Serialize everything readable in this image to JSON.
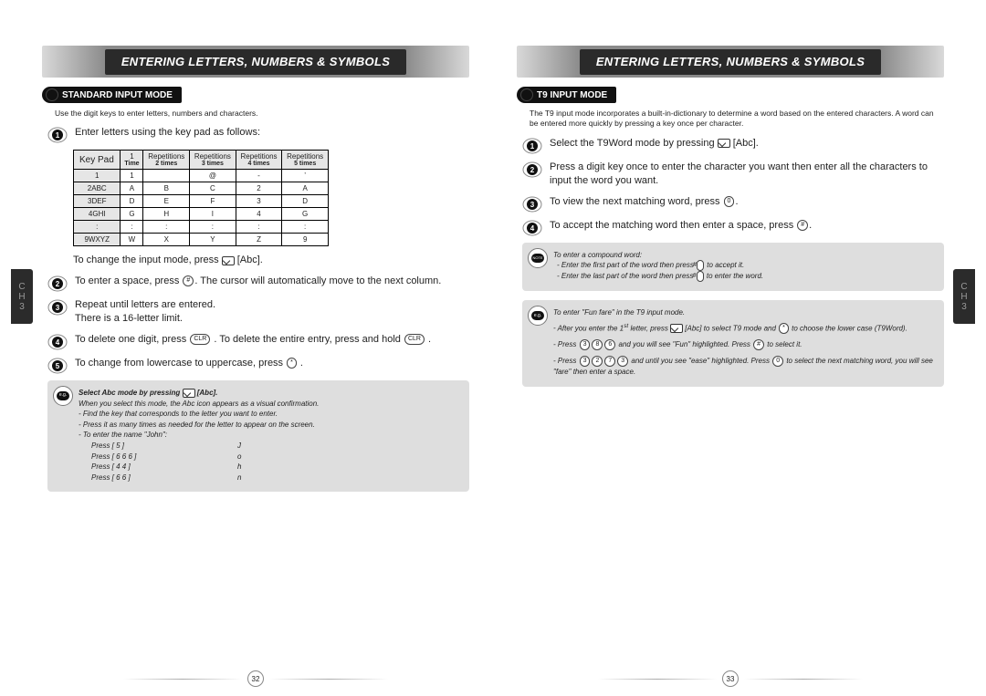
{
  "header": "ENTERING LETTERS, NUMBERS & SYMBOLS",
  "chapter_tab": {
    "line1": "C",
    "line2": "H",
    "line3": "3"
  },
  "left": {
    "section_title": "STANDARD INPUT MODE",
    "intro": "Use the digit keys to enter letters, numbers and characters.",
    "step1_a": "Enter letters using the key pad as follows:",
    "step1_b": "To change the input mode, press ",
    "step1_b2": " [Abc].",
    "step2": "To enter a space, press ",
    "step2b": ". The cursor will automatically move to the next column.",
    "step3a": "Repeat until letters are entered.",
    "step3b": "There is a 16-letter limit.",
    "step4a": "To delete one digit, press ",
    "step4b": " . To delete the entire entry, press and hold ",
    "step4c": " .",
    "step5a": "To change from lowercase to uppercase, press ",
    "step5b": " .",
    "table": {
      "head_keypad": "Key Pad",
      "head_cols": [
        {
          "top": "1",
          "sub": "Time"
        },
        {
          "top": "Repetitions",
          "sub": "2 times"
        },
        {
          "top": "Repetitions",
          "sub": "3 times"
        },
        {
          "top": "Repetitions",
          "sub": "4 times"
        },
        {
          "top": "Repetitions",
          "sub": "5 times"
        }
      ],
      "rows": [
        {
          "k": "1",
          "c": [
            "1",
            "",
            "@",
            "-",
            "’"
          ]
        },
        {
          "k": "2ABC",
          "c": [
            "A",
            "B",
            "C",
            "2",
            "A"
          ]
        },
        {
          "k": "3DEF",
          "c": [
            "D",
            "E",
            "F",
            "3",
            "D"
          ]
        },
        {
          "k": "4GHI",
          "c": [
            "G",
            "H",
            "I",
            "4",
            "G"
          ]
        },
        {
          "k": ":",
          "c": [
            ":",
            ":",
            ":",
            ":",
            ":"
          ]
        },
        {
          "k": "9WXYZ",
          "c": [
            "W",
            "X",
            "Y",
            "Z",
            "9"
          ]
        }
      ]
    },
    "eg": {
      "badge": "e.g.",
      "title_a": "Select Abc mode by pressing ",
      "title_b": " [Abc].",
      "line1": "When you select this mode, the Abc icon appears as a visual confirmation.",
      "li1": "Find the key that corresponds to the letter you want to enter.",
      "li2": "Press it as many times as needed for the letter to appear on the screen.",
      "li3": "To enter the name \"John\":",
      "press": [
        {
          "keys": "Press [ 5 ]",
          "out": "J"
        },
        {
          "keys": "Press [ 6 6 6 ]",
          "out": "o"
        },
        {
          "keys": "Press [ 4 4 ]",
          "out": "h"
        },
        {
          "keys": "Press [ 6 6 ]",
          "out": "n"
        }
      ]
    },
    "page_number": "32"
  },
  "right": {
    "section_title": "T9 INPUT MODE",
    "intro": "The T9 input mode incorporates a built-in-dictionary to determine a word based on the entered characters. A word can be entered more quickly by pressing a key once per character.",
    "step1a": "Select the T9Word mode by pressing ",
    "step1b": " [Abc].",
    "step2": "Press a digit key once to enter the character you want then enter all the characters to input the word you want.",
    "step3a": "To view the next matching word, press ",
    "step3b": ".",
    "step4a": "To accept the matching word then enter a space, press ",
    "step4b": ".",
    "note": {
      "badge": "NOTE",
      "title": "To enter a compound word:",
      "b1a": "Enter the first part of the word then press ",
      "b1b": " to accept it.",
      "b2a": "Enter the last part of the word then press ",
      "b2b": " to enter the word."
    },
    "eg": {
      "badge": "e.g.",
      "title": "To enter \"Fun fare\" in the T9 input mode.",
      "p1a": "After you enter the 1",
      "p1sup": "st",
      "p1b": " letter, press ",
      "p1c": " [Abc] to select T9 mode and ",
      "p1d": " to choose the lower case (T9Word).",
      "p2a": "Press ",
      "p2b": " and you will see \"Fun\" highlighted. Press ",
      "p2c": " to select it.",
      "p3a": "Press ",
      "p3b": " and until you see \"ease\" highlighted. Press ",
      "p3c": " to select the next matching word, you will see \"fare\" then enter a space."
    },
    "page_number": "33"
  },
  "keys": {
    "zero": "0",
    "pound": "#",
    "star": "*",
    "clr": "CLR",
    "k2": "2",
    "k3": "3",
    "k5": "5",
    "k6": "6",
    "k7": "7",
    "k8": "8"
  }
}
